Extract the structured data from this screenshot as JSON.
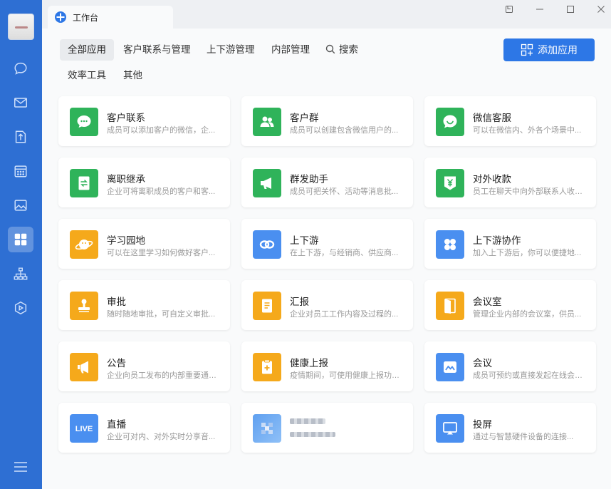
{
  "window": {
    "tab_title": "工作台",
    "controls": [
      "pin-icon",
      "minimize-icon",
      "maximize-icon",
      "close-icon"
    ]
  },
  "sidebar": {
    "items": [
      {
        "name": "chat",
        "icon": "chat-bubble-icon"
      },
      {
        "name": "mail",
        "icon": "mail-icon"
      },
      {
        "name": "docs",
        "icon": "document-icon"
      },
      {
        "name": "calendar",
        "icon": "calendar-icon"
      },
      {
        "name": "images",
        "icon": "image-icon"
      },
      {
        "name": "workbench",
        "icon": "grid-apps-icon",
        "active": true
      },
      {
        "name": "org",
        "icon": "org-chart-icon"
      },
      {
        "name": "meeting",
        "icon": "hexagon-play-icon"
      }
    ],
    "menu_icon": "hamburger-icon"
  },
  "filters": {
    "row1": [
      "全部应用",
      "客户联系与管理",
      "上下游管理",
      "内部管理"
    ],
    "search_label": "搜索",
    "row2": [
      "效率工具",
      "其他"
    ],
    "active": "全部应用"
  },
  "add_button": {
    "label": "添加应用"
  },
  "colors": {
    "sidebar": "#2e6fd3",
    "accent_blue": "#2d77e6",
    "green": "#2fb35a",
    "orange": "#f5a91b",
    "blue": "#4a8ff0"
  },
  "apps": [
    {
      "name": "客户联系",
      "desc": "成员可以添加客户的微信，企...",
      "color": "green",
      "icon": "wechat-bubble-icon"
    },
    {
      "name": "客户群",
      "desc": "成员可以创建包含微信用户的...",
      "color": "green",
      "icon": "group-people-icon"
    },
    {
      "name": "微信客服",
      "desc": "可以在微信内、外各个场景中...",
      "color": "green",
      "icon": "customer-service-icon"
    },
    {
      "name": "离职继承",
      "desc": "企业可将离职成员的客户和客...",
      "color": "green",
      "icon": "transfer-document-icon"
    },
    {
      "name": "群发助手",
      "desc": "成员可把关怀、活动等消息批...",
      "color": "green",
      "icon": "megaphone-icon"
    },
    {
      "name": "对外收款",
      "desc": "员工在聊天中向外部联系人收款...",
      "color": "green",
      "icon": "yuan-shield-icon"
    },
    {
      "name": "学习园地",
      "desc": "可以在这里学习如何做好客户...",
      "color": "orange",
      "icon": "planet-icon"
    },
    {
      "name": "上下游",
      "desc": "在上下游，与经销商、供应商...",
      "color": "blue",
      "icon": "link-rings-icon"
    },
    {
      "name": "上下游协作",
      "desc": "加入上下游后，你可以便捷地...",
      "color": "blue",
      "icon": "four-petals-icon"
    },
    {
      "name": "审批",
      "desc": "随时随地审批，可自定义审批...",
      "color": "orange",
      "icon": "stamp-icon"
    },
    {
      "name": "汇报",
      "desc": "企业对员工工作内容及过程的...",
      "color": "orange",
      "icon": "report-document-icon"
    },
    {
      "name": "会议室",
      "desc": "管理企业内部的会议室，供员...",
      "color": "orange",
      "icon": "door-icon"
    },
    {
      "name": "公告",
      "desc": "企业向员工发布的内部重要通知...",
      "color": "orange",
      "icon": "announcement-icon"
    },
    {
      "name": "健康上报",
      "desc": "疫情期间，可使用健康上报功能...",
      "color": "orange",
      "icon": "health-clipboard-icon"
    },
    {
      "name": "会议",
      "desc": "成员可预约或直接发起在线会议...",
      "color": "blue",
      "icon": "meeting-mountain-icon"
    },
    {
      "name": "直播",
      "desc": "企业可对内、对外实时分享音...",
      "color": "blue",
      "icon": "live-icon",
      "icon_text": "LIVE"
    },
    {
      "name": "",
      "desc": "",
      "color": "pixel",
      "icon": "blurred-app-icon",
      "blurred": true
    },
    {
      "name": "投屏",
      "desc": "通过与智慧硬件设备的连接...",
      "color": "blue",
      "icon": "screen-cast-icon"
    }
  ]
}
